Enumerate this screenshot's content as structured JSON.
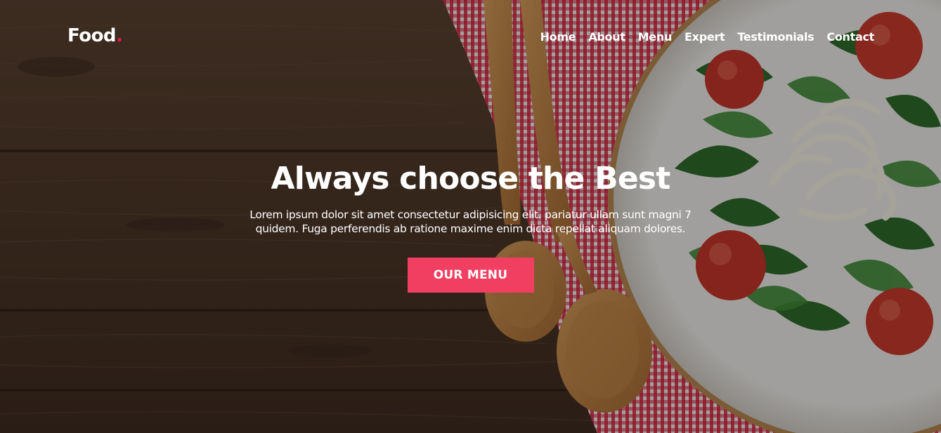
{
  "brand": {
    "name": "Food",
    "dot": "."
  },
  "nav": {
    "items": [
      "Home",
      "About",
      "Menu",
      "Expert",
      "Testimonials",
      "Contact"
    ]
  },
  "hero": {
    "headline": "Always choose the Best",
    "lead": "Lorem ipsum dolor sit amet consectetur adipisicing elit. pariatur ullam sunt magni 7 quidem. Fuga perferendis ab ratione maxime enim dicta repellat aliquam dolores.",
    "cta_label": "OUR MENU"
  },
  "colors": {
    "accent": "#f13f62",
    "brand_dot": "#e8174a",
    "text": "#ffffff",
    "wood": "#4a3426"
  }
}
